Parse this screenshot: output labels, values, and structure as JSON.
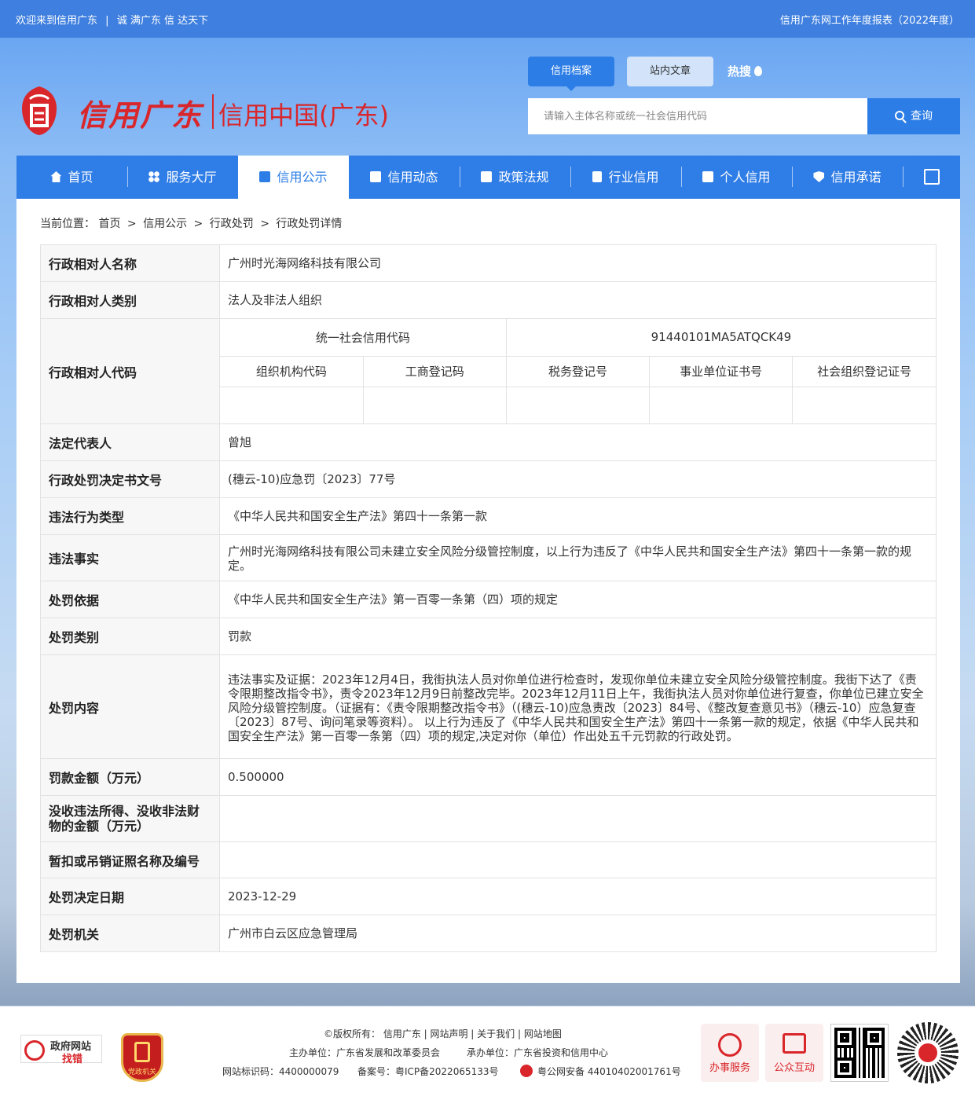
{
  "topbar": {
    "welcome": "欢迎来到信用广东",
    "divider": "|",
    "slogan": "诚 满广东   信 达天下",
    "report_link": "信用广东网工作年度报表（2022年度）"
  },
  "header": {
    "logo_text1": "信用广东",
    "logo_text2": "信用中国(广东)",
    "search_tabs": [
      "信用档案",
      "站内文章"
    ],
    "hot_label": "热搜",
    "search_placeholder": "请输入主体名称或统一社会信用代码",
    "search_button": "查询"
  },
  "nav": {
    "items": [
      "首页",
      "服务大厅",
      "信用公示",
      "信用动态",
      "政策法规",
      "行业信用",
      "个人信用",
      "信用承诺"
    ],
    "active_index": 2
  },
  "breadcrumb": {
    "label": "当前位置：",
    "items": [
      "首页",
      "信用公示",
      "行政处罚",
      "行政处罚详情"
    ],
    "separator": ">"
  },
  "record": {
    "name_key": "行政相对人名称",
    "name_val": "广州时光海网络科技有限公司",
    "category_key": "行政相对人类别",
    "category_val": "法人及非法人组织",
    "code_key": "行政相对人代码",
    "uscc_label": "统一社会信用代码",
    "uscc_val": "91440101MA5ATQCK49",
    "code_headers": [
      "组织机构代码",
      "工商登记码",
      "税务登记号",
      "事业单位证书号",
      "社会组织登记证号"
    ],
    "code_values": [
      "",
      "",
      "",
      "",
      ""
    ],
    "legal_rep_key": "法定代表人",
    "legal_rep_val": "曾旭",
    "doc_no_key": "行政处罚决定书文号",
    "doc_no_val": "(穗云-10)应急罚〔2023〕77号",
    "violation_type_key": "违法行为类型",
    "violation_type_val": "《中华人民共和国安全生产法》第四十一条第一款",
    "facts_key": "违法事实",
    "facts_val": "广州时光海网络科技有限公司未建立安全风险分级管控制度，以上行为违反了《中华人民共和国安全生产法》第四十一条第一款的规定。",
    "basis_key": "处罚依据",
    "basis_val": "《中华人民共和国安全生产法》第一百零一条第（四）项的规定",
    "penalty_type_key": "处罚类别",
    "penalty_type_val": "罚款",
    "content_key": "处罚内容",
    "content_val": "违法事实及证据：2023年12月4日，我街执法人员对你单位进行检查时，发现你单位未建立安全风险分级管控制度。我街下达了《责令限期整改指令书》，责令2023年12月9日前整改完毕。2023年12月11日上午，我街执法人员对你单位进行复查，你单位已建立安全风险分级管控制度。（证据有：《责令限期整改指令书》（(穗云-10)应急责改〔2023〕84号、《整改复查意见书》（穗云-10）应急复查〔2023〕87号、询问笔录等资料）。 以上行为违反了《中华人民共和国安全生产法》第四十一条第一款的规定，依据《中华人民共和国安全生产法》第一百零一条第（四）项的规定,决定对你（单位）作出处五千元罚款的行政处罚。",
    "fine_key": "罚款金额（万元）",
    "fine_val": "0.500000",
    "confiscation_key": "没收违法所得、没收非法财物的金额（万元）",
    "confiscation_val": "",
    "license_key": "暂扣或吊销证照名称及编号",
    "license_val": "",
    "date_key": "处罚决定日期",
    "date_val": "2023-12-29",
    "authority_key": "处罚机关",
    "authority_val": "广州市白云区应急管理局"
  },
  "footer": {
    "gov_site_line1": "政府网站",
    "gov_site_line2": "找错",
    "party_label": "党政机关",
    "links": "©版权所有： 信用广东  |  网站声明  |  关于我们  |  网站地图",
    "host": "主办单位：广东省发展和改革委员会",
    "operator": "承办单位：广东省投资和信用中心",
    "site_id": "网站标识码：4400000079",
    "icp": "备案号：粤ICP备2022065133号",
    "police": "粤公网安备 44010402001761号",
    "btn_service": "办事服务",
    "btn_interact": "公众互动"
  }
}
